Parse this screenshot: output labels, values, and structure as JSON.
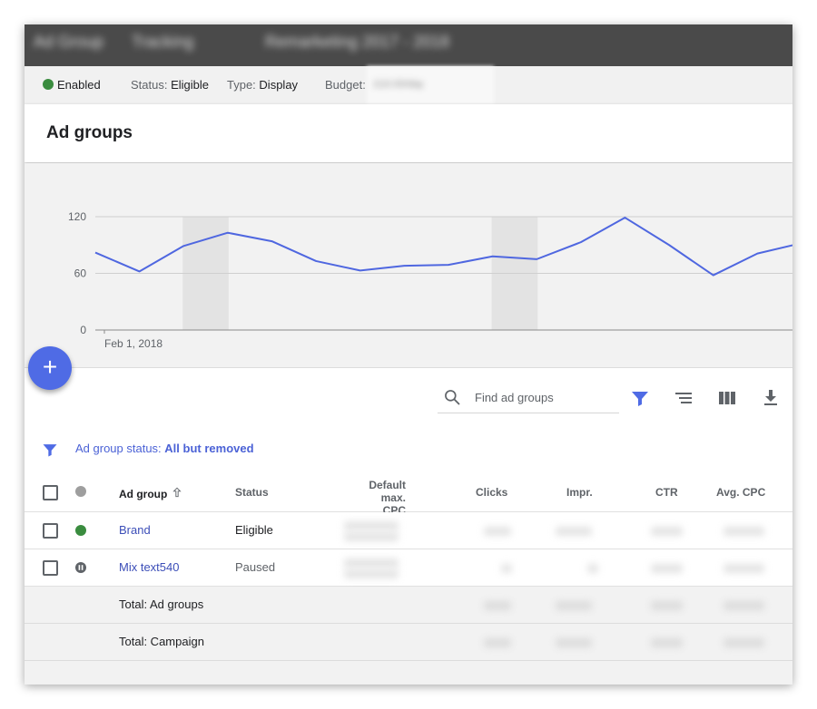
{
  "breadcrumb_blurred": [
    "Ad Group",
    "Tracking",
    "Remarketing 2017 - 2018"
  ],
  "status_bar": {
    "enabled_label": "Enabled",
    "status_label": "Status:",
    "status_value": "Eligible",
    "type_label": "Type:",
    "type_value": "Display",
    "budget_label": "Budget:",
    "budget_value_blurred": "£10.00/day"
  },
  "panel": {
    "title": "Ad groups"
  },
  "chart_data": {
    "type": "line",
    "title": "",
    "xlabel": "",
    "ylabel": "",
    "x_tick_label": "Feb 1, 2018",
    "ytick_labels": [
      "120",
      "60",
      "0"
    ],
    "ylim": [
      0,
      120
    ],
    "grid": true,
    "series": [
      {
        "values": [
          82,
          62,
          89,
          103,
          94,
          73,
          63,
          68,
          69,
          78,
          75,
          93,
          119,
          90,
          58,
          81,
          92
        ]
      }
    ],
    "shaded_bands": [
      [
        2,
        3
      ],
      [
        9,
        10
      ]
    ],
    "line_color": "#4f67e0"
  },
  "fab": {
    "icon": "plus-icon",
    "label": "+"
  },
  "toolbar": {
    "search_placeholder": "Find ad groups",
    "icons": [
      "search-icon",
      "filter-icon",
      "segment-icon",
      "columns-icon",
      "download-icon"
    ],
    "accent": "#4f6be5"
  },
  "filter": {
    "label": "Ad group status:",
    "value": "All but removed"
  },
  "table": {
    "headers": {
      "ad_group": "Ad group",
      "status": "Status",
      "default_cpc_line1": "Default max.",
      "default_cpc_line2": "CPC",
      "clicks": "Clicks",
      "impr": "Impr.",
      "ctr": "CTR",
      "avg_cpc": "Avg. CPC"
    },
    "rows": [
      {
        "name": "Brand",
        "status": "Eligible",
        "status_color": "#3a8c3f"
      },
      {
        "name": "Mix text540",
        "status": "Paused",
        "status_color": "#5f6368"
      }
    ],
    "totals": [
      {
        "label": "Total: Ad groups"
      },
      {
        "label": "Total: Campaign"
      }
    ]
  }
}
